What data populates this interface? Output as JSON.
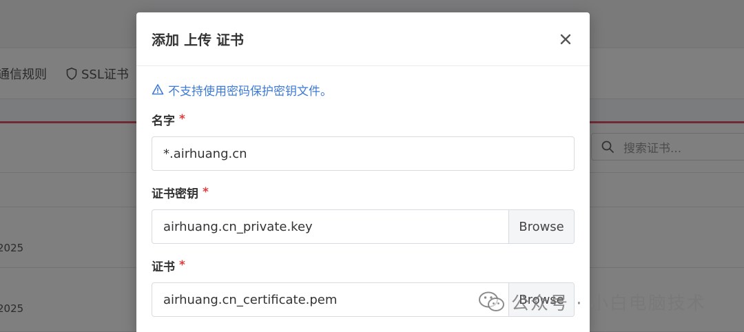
{
  "background": {
    "tabs": [
      {
        "label": "通信规则"
      },
      {
        "label": "SSL证书"
      }
    ],
    "search_placeholder": "搜索证书...",
    "row_dates": [
      "2025",
      "2025"
    ]
  },
  "modal": {
    "title": "添加 上传 证书",
    "warning": "不支持使用密码保护密钥文件。",
    "fields": {
      "name": {
        "label": "名字",
        "required_mark": "*",
        "value": "*.airhuang.cn"
      },
      "key": {
        "label": "证书密钥",
        "required_mark": "*",
        "file": "airhuang.cn_private.key",
        "browse": "Browse"
      },
      "cert": {
        "label": "证书",
        "required_mark": "*",
        "file": "airhuang.cn_certificate.pem",
        "browse": "Browse"
      }
    }
  },
  "watermark": {
    "text": "公众号 · 小白电脑技术"
  },
  "colors": {
    "accent": "#3d7ad6",
    "required": "#e03c3c",
    "danger_line": "#e0546b"
  }
}
